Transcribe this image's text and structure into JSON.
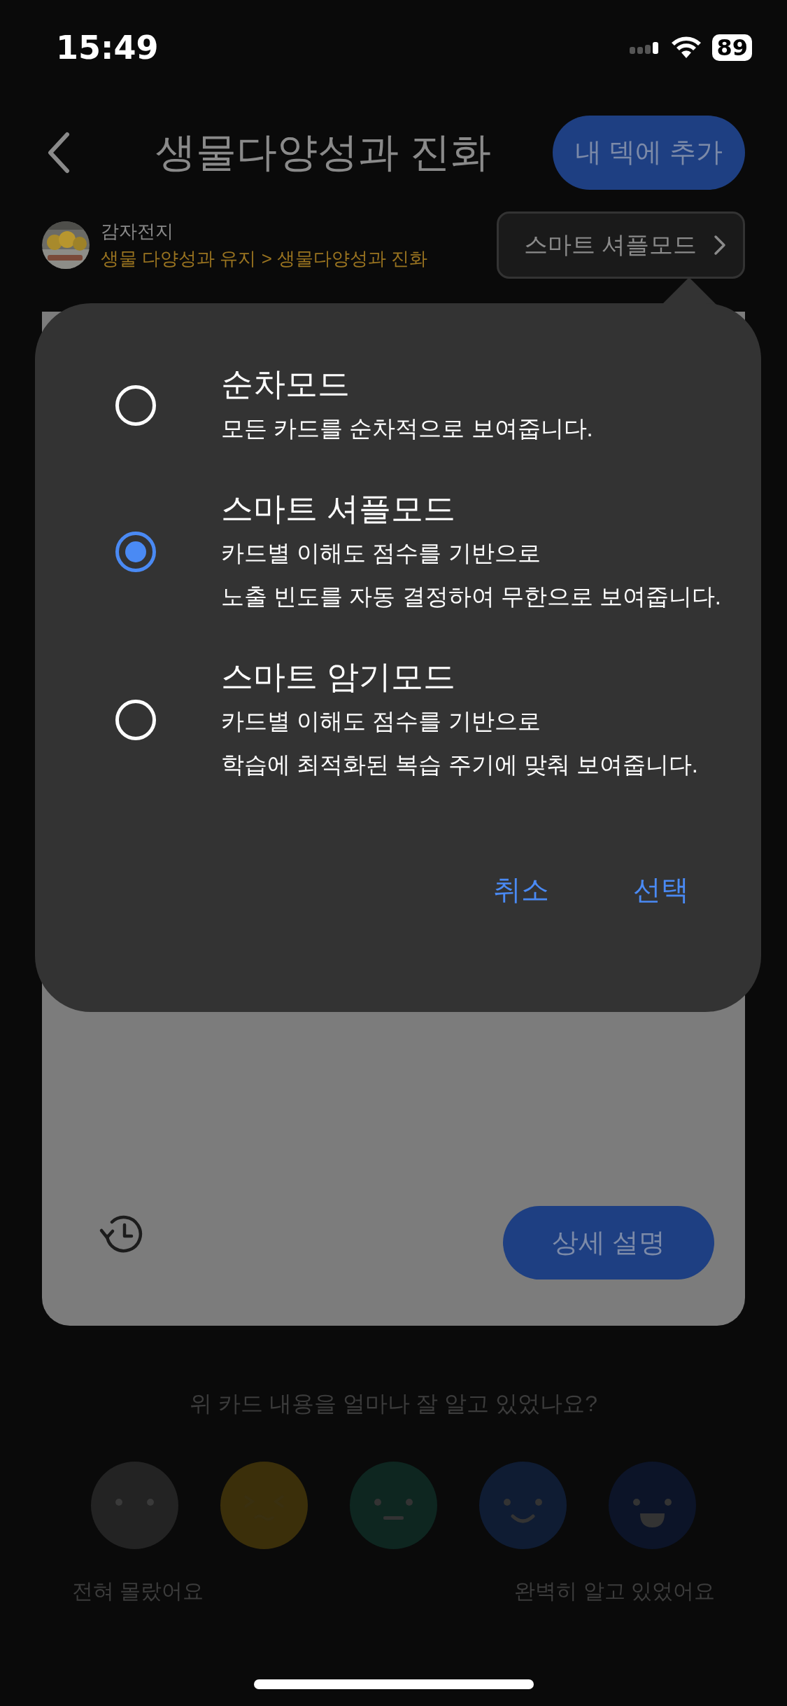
{
  "status_bar": {
    "time": "15:49",
    "battery": "89"
  },
  "header": {
    "title": "생물다양성과 진화",
    "add_button": "내 덱에 추가"
  },
  "author": {
    "name": "감자전지",
    "breadcrumb": "생물 다양성과 유지 > 생물다양성과 진화"
  },
  "mode_button": {
    "label": "스마트 셔플모드"
  },
  "mode_popover": {
    "options": [
      {
        "title": "순차모드",
        "description": "모든 카드를 순차적으로 보여줍니다.",
        "selected": false
      },
      {
        "title": "스마트 셔플모드",
        "description": "카드별 이해도 점수를 기반으로\n노출 빈도를 자동 결정하여 무한으로 보여줍니다.",
        "selected": true
      },
      {
        "title": "스마트 암기모드",
        "description": "카드별 이해도 점수를 기반으로\n학습에 최적화된 복습 주기에 맞춰 보여줍니다.",
        "selected": false
      }
    ],
    "buttons": [
      "취소",
      "선택"
    ]
  },
  "card": {
    "detail_button": "상세 설명"
  },
  "rating": {
    "question": "위 카드 내용을 얼마나 잘 알고 있었나요?",
    "faces": [
      {
        "kind": "blank",
        "color": "#232323"
      },
      {
        "kind": "squint",
        "color": "#3b2f0a"
      },
      {
        "kind": "neutral",
        "color": "#0e2620"
      },
      {
        "kind": "smile",
        "color": "#0f1c33"
      },
      {
        "kind": "grin",
        "color": "#0c1428"
      }
    ],
    "low_label": "전혀 몰랐어요",
    "high_label": "완벽히 알고 있었어요"
  }
}
